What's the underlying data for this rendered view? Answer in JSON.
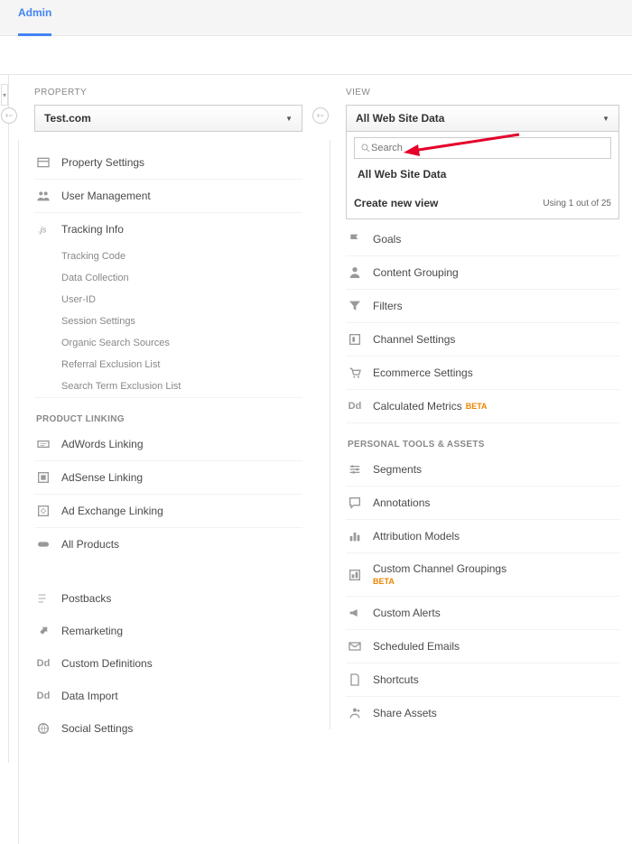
{
  "header": {
    "tab_admin": "Admin"
  },
  "property": {
    "header": "PROPERTY",
    "selected": "Test.com",
    "items": {
      "settings": "Property Settings",
      "user_management": "User Management",
      "tracking_info": "Tracking Info"
    },
    "tracking_sub": [
      "Tracking Code",
      "Data Collection",
      "User-ID",
      "Session Settings",
      "Organic Search Sources",
      "Referral Exclusion List",
      "Search Term Exclusion List"
    ],
    "product_linking_label": "PRODUCT LINKING",
    "linking": {
      "adwords": "AdWords Linking",
      "adsense": "AdSense Linking",
      "adexchange": "Ad Exchange Linking",
      "all_products": "All Products"
    },
    "extras": {
      "postbacks": "Postbacks",
      "remarketing": "Remarketing",
      "custom_definitions": "Custom Definitions",
      "data_import": "Data Import",
      "social_settings": "Social Settings"
    }
  },
  "view": {
    "header": "VIEW",
    "selected": "All Web Site Data",
    "search_placeholder": "Search",
    "panel_option": "All Web Site Data",
    "create_new": "Create new view",
    "using_count": "Using 1 out of 25",
    "items": {
      "goals": "Goals",
      "content_grouping": "Content Grouping",
      "filters": "Filters",
      "channel_settings": "Channel Settings",
      "ecommerce_settings": "Ecommerce Settings",
      "calculated_metrics": "Calculated Metrics",
      "calculated_metrics_beta": "BETA"
    },
    "personal_label": "PERSONAL TOOLS & ASSETS",
    "personal": {
      "segments": "Segments",
      "annotations": "Annotations",
      "attribution": "Attribution Models",
      "ccg": "Custom Channel Groupings",
      "ccg_beta": "BETA",
      "custom_alerts": "Custom Alerts",
      "scheduled_emails": "Scheduled Emails",
      "shortcuts": "Shortcuts",
      "share_assets": "Share Assets"
    }
  }
}
